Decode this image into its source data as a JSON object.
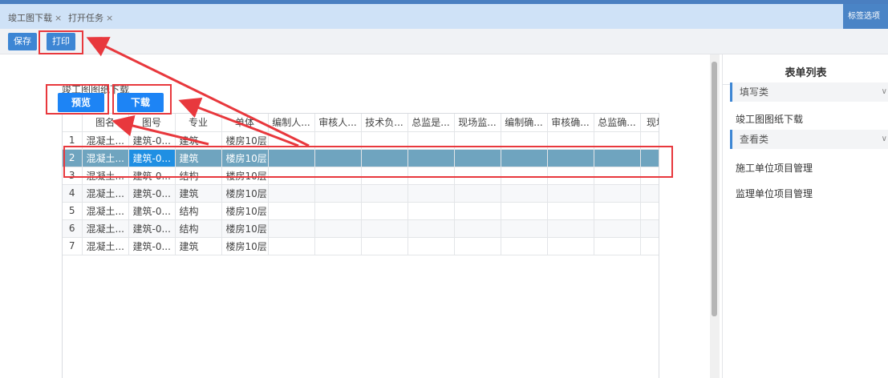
{
  "tabs": [
    {
      "label": "竣工图下载",
      "close": "×"
    },
    {
      "label": "打开任务",
      "close": "×"
    }
  ],
  "tab_options_label": "标签选项 ∨",
  "toolbar": {
    "save_label": "保存",
    "print_label": "打印"
  },
  "main": {
    "section_title": "竣工图图纸下载",
    "preview_label": "预览",
    "download_label": "下载"
  },
  "table": {
    "headers": [
      "",
      "图名",
      "图号",
      "专业",
      "单体",
      "编制人...",
      "审核人...",
      "技术负...",
      "总监是...",
      "现场监...",
      "编制确...",
      "审核确...",
      "总监确...",
      "现场"
    ],
    "rows": [
      [
        "1",
        "混凝土...",
        "建筑-0...",
        "建筑",
        "楼房10层"
      ],
      [
        "2",
        "混凝土...",
        "建筑-0...",
        "建筑",
        "楼房10层"
      ],
      [
        "3",
        "混凝土...",
        "建筑-0...",
        "结构",
        "楼房10层"
      ],
      [
        "4",
        "混凝土...",
        "建筑-0...",
        "建筑",
        "楼房10层"
      ],
      [
        "5",
        "混凝土...",
        "建筑-0...",
        "结构",
        "楼房10层"
      ],
      [
        "6",
        "混凝土...",
        "建筑-0...",
        "结构",
        "楼房10层"
      ],
      [
        "7",
        "混凝土...",
        "建筑-0...",
        "建筑",
        "楼房10层"
      ]
    ]
  },
  "side": {
    "title": "表单列表",
    "group_fill": "填写类",
    "item_download": "竣工图图纸下载",
    "group_view": "查看类",
    "item_construction": "施工单位项目管理",
    "item_supervision": "监理单位项目管理",
    "chevron": "∨"
  },
  "colors": {
    "accent": "#1d84f5",
    "highlight": "#e8383d",
    "selected_row": "#6fa4bf",
    "tabbar": "#cfe2f7"
  }
}
